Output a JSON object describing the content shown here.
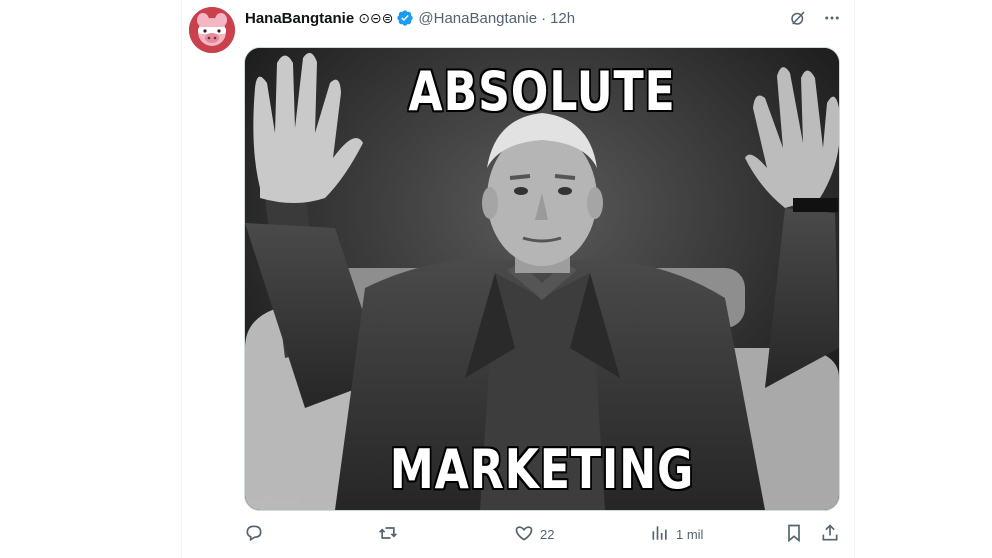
{
  "tweet": {
    "display_name": "HanaBangtanie",
    "name_emoji": "⊙⊝⊜",
    "handle": "@HanaBangtanie",
    "separator": "·",
    "time": "12h"
  },
  "media": {
    "top_text": "ABSOLUTE",
    "bottom_text": "MARKETING",
    "watermark": "imgflip.com"
  },
  "actions": {
    "reply_count": "",
    "retweet_count": "",
    "like_count": "22",
    "views_count": "1 mil"
  },
  "colors": {
    "verified": "#1d9bf0",
    "secondary_text": "#536471",
    "primary_text": "#0f1419",
    "border": "#cfd9de"
  },
  "icons": {
    "header": [
      "grok-icon",
      "more-icon"
    ],
    "actions": [
      "reply-icon",
      "retweet-icon",
      "like-icon",
      "views-icon",
      "bookmark-icon",
      "share-icon"
    ]
  }
}
